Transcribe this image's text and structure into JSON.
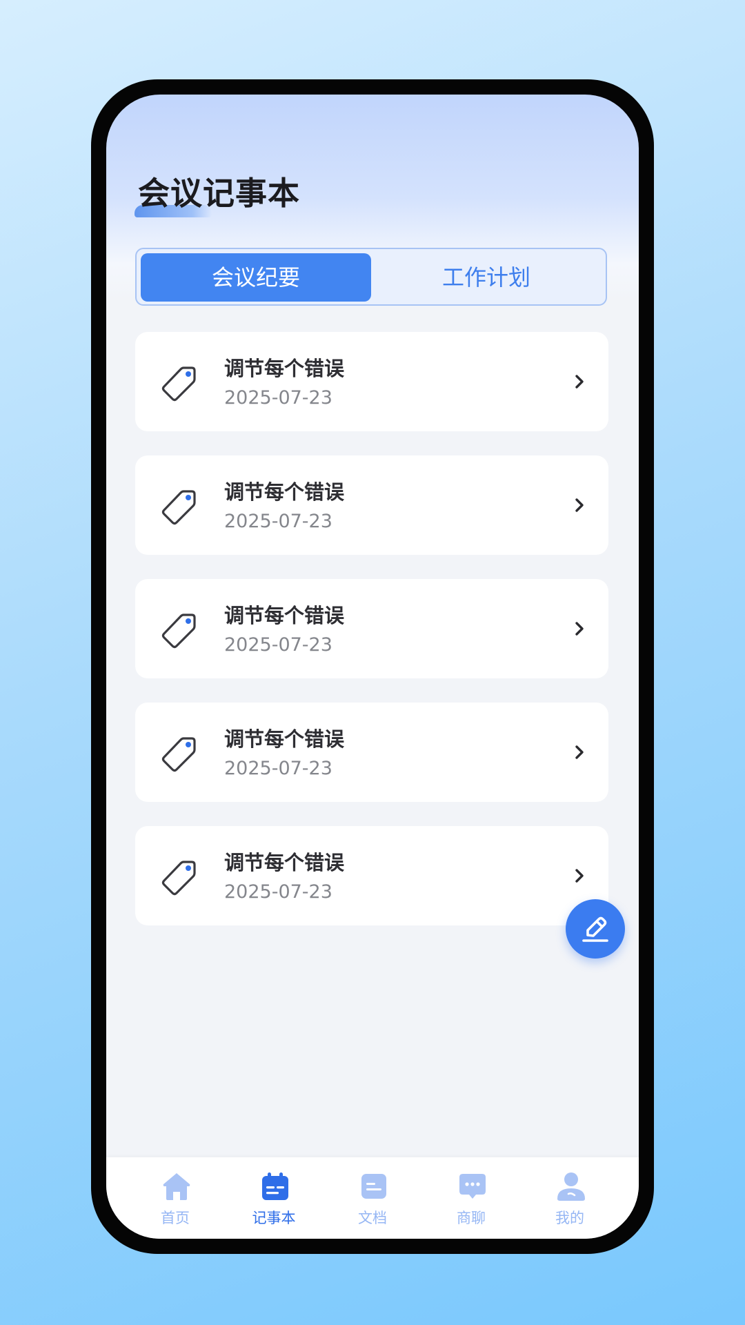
{
  "header": {
    "title": "会议记事本"
  },
  "tabs": [
    {
      "label": "会议纪要",
      "active": true
    },
    {
      "label": "工作计划",
      "active": false
    }
  ],
  "notes": [
    {
      "title": "调节每个错误",
      "date": "2025-07-23"
    },
    {
      "title": "调节每个错误",
      "date": "2025-07-23"
    },
    {
      "title": "调节每个错误",
      "date": "2025-07-23"
    },
    {
      "title": "调节每个错误",
      "date": "2025-07-23"
    },
    {
      "title": "调节每个错误",
      "date": "2025-07-23"
    }
  ],
  "icons": {
    "note_item": "tag-icon",
    "note_arrow": "chevron-right-icon",
    "fab": "edit-pencil-icon"
  },
  "bottom_nav": [
    {
      "label": "首页",
      "icon": "home-icon",
      "active": false
    },
    {
      "label": "记事本",
      "icon": "calendar-notebook-icon",
      "active": true
    },
    {
      "label": "文档",
      "icon": "document-icon",
      "active": false
    },
    {
      "label": "商聊",
      "icon": "chat-bubble-icon",
      "active": false
    },
    {
      "label": "我的",
      "icon": "user-icon",
      "active": false
    }
  ],
  "colors": {
    "accent": "#4285f1",
    "nav_active": "#2f6ee8",
    "nav_inactive": "#95b6f4",
    "tag_dot": "#2f6fe8"
  }
}
